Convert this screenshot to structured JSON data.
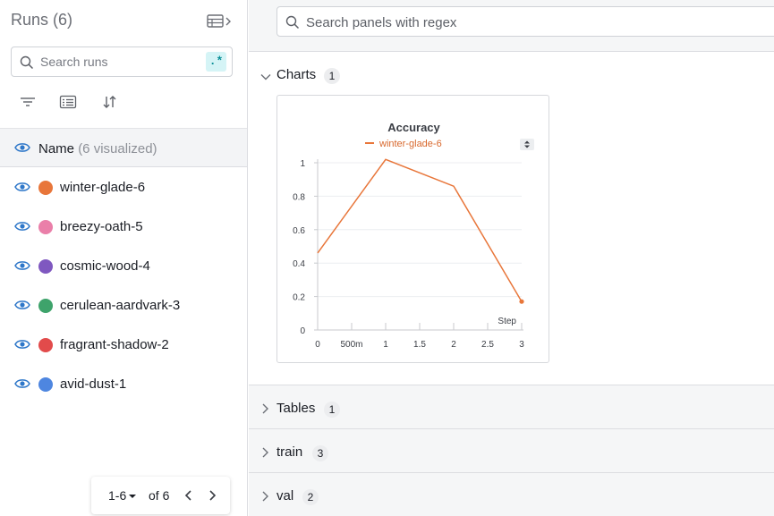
{
  "runs_panel": {
    "title": "Runs (6)",
    "search": {
      "placeholder": "Search runs",
      "regex_label": ".*"
    },
    "tools": [
      "filter-icon",
      "group-icon",
      "sort-icon"
    ],
    "name_header": {
      "label": "Name",
      "sub": "(6 visualized)"
    },
    "runs": [
      {
        "name": "winter-glade-6",
        "color": "#e8763a"
      },
      {
        "name": "breezy-oath-5",
        "color": "#ea7fa9"
      },
      {
        "name": "cosmic-wood-4",
        "color": "#7f58c0"
      },
      {
        "name": "cerulean-aardvark-3",
        "color": "#3ea36b"
      },
      {
        "name": "fragrant-shadow-2",
        "color": "#e24b4b"
      },
      {
        "name": "avid-dust-1",
        "color": "#4e86e0"
      }
    ],
    "pager": {
      "range": "1-6",
      "of": "of 6"
    }
  },
  "workspace": {
    "search": {
      "placeholder": "Search panels with regex"
    },
    "sections": [
      {
        "title": "Charts",
        "count": "1",
        "expanded": true
      },
      {
        "title": "Tables",
        "count": "1",
        "expanded": false
      },
      {
        "title": "train",
        "count": "3",
        "expanded": false
      },
      {
        "title": "val",
        "count": "2",
        "expanded": false
      }
    ]
  },
  "chart_data": {
    "type": "line",
    "title": "Accuracy",
    "xlabel": "Step",
    "ylabel": "",
    "x": [
      0,
      1,
      2,
      3
    ],
    "series": [
      {
        "name": "winter-glade-6",
        "color": "#e8763a",
        "values": [
          0.46,
          1.02,
          0.86,
          0.17
        ]
      }
    ],
    "xlim": [
      0,
      3
    ],
    "ylim": [
      0,
      1
    ],
    "x_tick_labels": [
      "0",
      "500m",
      "1",
      "1.5",
      "2",
      "2.5",
      "3"
    ],
    "y_tick_labels": [
      "0",
      "0.2",
      "0.4",
      "0.6",
      "0.8",
      "1"
    ],
    "grid": true
  },
  "colors": {
    "accent_teal": "#0a8f97",
    "eye_blue": "#2e77c9"
  }
}
